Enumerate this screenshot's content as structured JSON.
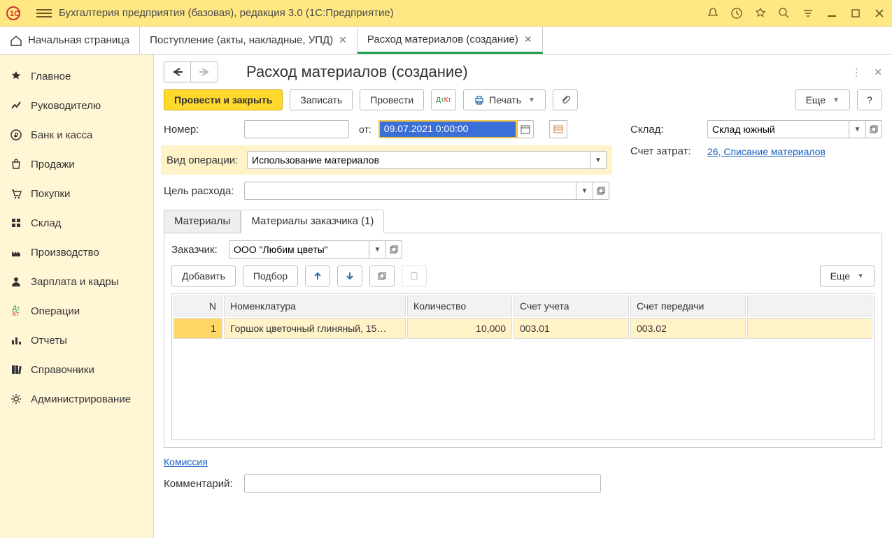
{
  "titlebar": {
    "title": "Бухгалтерия предприятия (базовая), редакция 3.0  (1С:Предприятие)"
  },
  "tabs": {
    "home": "Начальная страница",
    "t1": "Поступление (акты, накладные, УПД)",
    "t2": "Расход материалов (создание)"
  },
  "sidebar": [
    {
      "label": "Главное",
      "icon": "star"
    },
    {
      "label": "Руководителю",
      "icon": "chart"
    },
    {
      "label": "Банк и касса",
      "icon": "ruble"
    },
    {
      "label": "Продажи",
      "icon": "bag"
    },
    {
      "label": "Покупки",
      "icon": "cart"
    },
    {
      "label": "Склад",
      "icon": "boxes"
    },
    {
      "label": "Производство",
      "icon": "factory"
    },
    {
      "label": "Зарплата и кадры",
      "icon": "person"
    },
    {
      "label": "Операции",
      "icon": "dtkt"
    },
    {
      "label": "Отчеты",
      "icon": "bars"
    },
    {
      "label": "Справочники",
      "icon": "books"
    },
    {
      "label": "Администрирование",
      "icon": "gear"
    }
  ],
  "page": {
    "title": "Расход материалов (создание)",
    "post_close": "Провести и закрыть",
    "save": "Записать",
    "post": "Провести",
    "print": "Печать",
    "more": "Еще",
    "help": "?",
    "number_label": "Номер:",
    "number_value": "",
    "from_label": "от:",
    "date_value": "09.07.2021  0:00:00",
    "op_label": "Вид операции:",
    "op_value": "Использование материалов",
    "purpose_label": "Цель расхода:",
    "purpose_value": "",
    "wh_label": "Склад:",
    "wh_value": "Склад южный",
    "acct_label": "Счет затрат:",
    "acct_link": "26, Списание материалов",
    "innertabs": {
      "materials": "Материалы",
      "customer_materials": "Материалы заказчика (1)"
    },
    "customer_label": "Заказчик:",
    "customer_value": "ООО \"Любим цветы\"",
    "add": "Добавить",
    "pick": "Подбор",
    "tbl_more": "Еще",
    "table": {
      "cols": [
        "N",
        "Номенклатура",
        "Количество",
        "Счет учета",
        "Счет передачи"
      ],
      "row": {
        "n": "1",
        "nom": "Горшок цветочный глиняный, 15…",
        "qty": "10,000",
        "acc1": "003.01",
        "acc2": "003.02"
      }
    },
    "commission": "Комиссия",
    "comment_label": "Комментарий:",
    "comment_value": ""
  }
}
